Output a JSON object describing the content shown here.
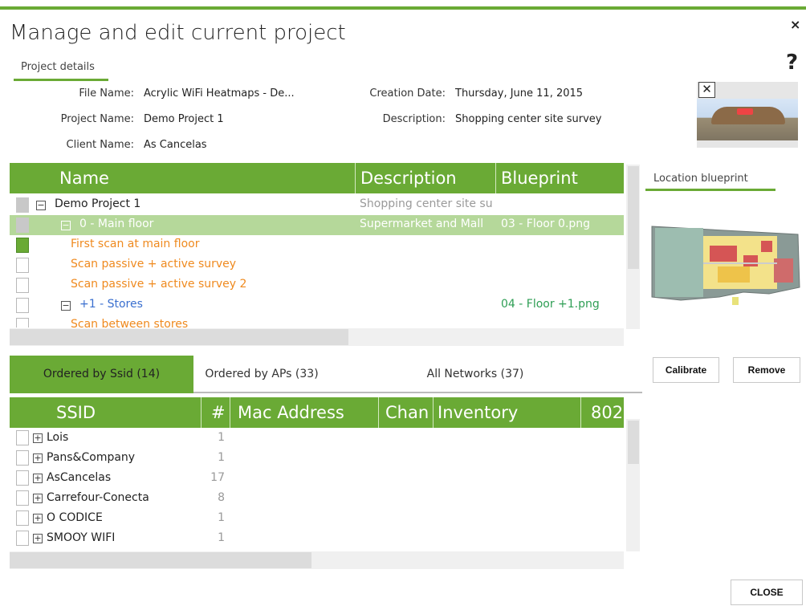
{
  "dialog": {
    "title": "Manage and edit current project",
    "close_glyph": "×",
    "help_glyph": "?",
    "details_tab": "Project details",
    "close_button": "CLOSE"
  },
  "details": {
    "file_name_label": "File Name:",
    "file_name": "Acrylic WiFi Heatmaps - De...",
    "project_name_label": "Project Name:",
    "project_name": "Demo Project 1",
    "client_name_label": "Client Name:",
    "client_name": "As Cancelas",
    "creation_date_label": "Creation Date:",
    "creation_date": "Thursday, June 11, 2015",
    "description_label": "Description:",
    "description": "Shopping center site survey",
    "thumbnail_close": "✕"
  },
  "project_table": {
    "columns": [
      "Name",
      "Description",
      "Blueprint"
    ],
    "rows": [
      {
        "name": "Demo Project 1",
        "description": "Shopping center site su",
        "blueprint": "",
        "color": "#222222",
        "check": "gray",
        "expander": "−",
        "selected": false
      },
      {
        "name": "0 - Main floor",
        "description": "Supermarket and Mall",
        "blueprint": "03 - Floor 0.png",
        "color": "#ffffff",
        "check": "gray",
        "expander": "−",
        "selected": true
      },
      {
        "name": "First scan at main floor",
        "description": "",
        "blueprint": "",
        "color": "#ef8a1f",
        "check": "green",
        "expander": "",
        "selected": false
      },
      {
        "name": "Scan passive + active survey",
        "description": "",
        "blueprint": "",
        "color": "#ef8a1f",
        "check": "empty",
        "expander": "",
        "selected": false
      },
      {
        "name": "Scan passive + active survey 2",
        "description": "",
        "blueprint": "",
        "color": "#ef8a1f",
        "check": "empty",
        "expander": "",
        "selected": false
      },
      {
        "name": "+1 - Stores",
        "description": "",
        "blueprint": "04 - Floor +1.png",
        "color": "#3a6fcf",
        "check": "empty",
        "expander": "−",
        "selected": false
      },
      {
        "name": "Scan between stores",
        "description": "",
        "blueprint": "",
        "color": "#ef8a1f",
        "check": "empty",
        "expander": "",
        "selected": false
      }
    ]
  },
  "location": {
    "tab": "Location blueprint",
    "calibrate": "Calibrate",
    "remove": "Remove"
  },
  "network_tabs": [
    {
      "label": "Ordered by Ssid (14)",
      "active": true
    },
    {
      "label": "Ordered by APs  (33)",
      "active": false
    },
    {
      "label": "All Networks (37)",
      "active": false
    }
  ],
  "network_table": {
    "columns": [
      "SSID",
      "#",
      "Mac Address",
      "Chan",
      "Inventory",
      "802"
    ],
    "rows": [
      {
        "ssid": "Lois",
        "count": "1"
      },
      {
        "ssid": "Pans&Company",
        "count": "1"
      },
      {
        "ssid": "AsCancelas",
        "count": "17"
      },
      {
        "ssid": "Carrefour-Conecta",
        "count": "8"
      },
      {
        "ssid": "O CODICE",
        "count": "1"
      },
      {
        "ssid": "SMOOY WIFI",
        "count": "1"
      }
    ]
  },
  "colors": {
    "accent": "#6aaa35",
    "selected_row": "#b5d89a",
    "scan_text": "#ef8a1f",
    "floor_link": "#3a6fcf",
    "blueprint_green": "#2e9e54"
  }
}
